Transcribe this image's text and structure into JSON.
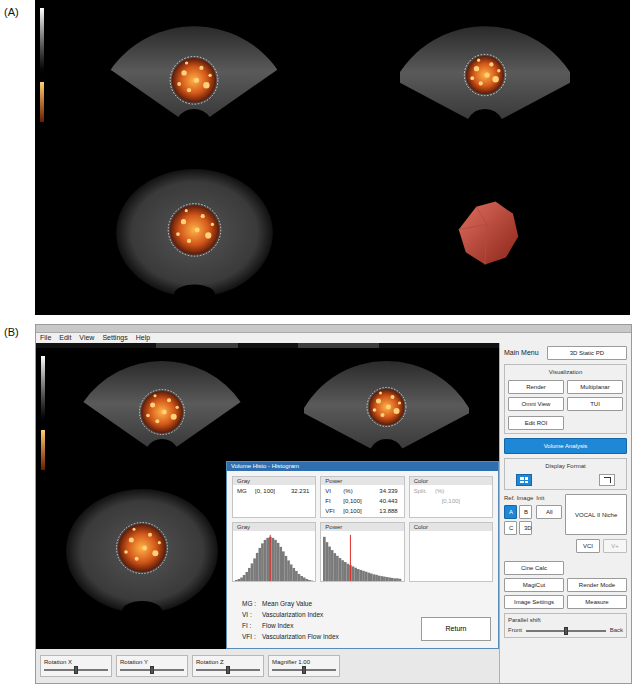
{
  "panel_a": {
    "label": "(A)"
  },
  "panel_b": {
    "label": "(B)"
  },
  "window": {
    "menu": [
      "File",
      "Edit",
      "View",
      "Settings",
      "Help"
    ]
  },
  "side_panel": {
    "title": "Main Menu",
    "mode": "3D Static PD",
    "visualization": {
      "title": "Visualization",
      "buttons": [
        {
          "label": "Render",
          "selected": false
        },
        {
          "label": "Multiplanar",
          "selected": false
        },
        {
          "label": "Omni View",
          "selected": false
        },
        {
          "label": "TUI",
          "selected": false
        }
      ]
    },
    "edit_roi": {
      "label": "Edit ROI"
    },
    "volume_analysis": {
      "label": "Volume Analysis",
      "selected": true
    },
    "display_format": {
      "title": "Display Format",
      "options": [
        {
          "selected": true
        },
        {
          "selected": false
        }
      ]
    },
    "ref_image": {
      "title": "Ref. Image",
      "options": [
        {
          "label": "A",
          "selected": true
        },
        {
          "label": "B",
          "selected": false
        },
        {
          "label": "C",
          "selected": false
        },
        {
          "label": "3D",
          "selected": false
        }
      ]
    },
    "init": {
      "title": "Init",
      "button": "All"
    },
    "vocal": {
      "label": "VOCAL II Niche"
    },
    "vci": [
      {
        "label": "VCI",
        "disabled": false
      },
      {
        "label": "V+",
        "disabled": true
      }
    ],
    "tools": [
      "Cine Calc",
      "MagiCut",
      "Render Mode",
      "Image Settings",
      "Measure"
    ],
    "parallel_shift": {
      "title": "Parallel shift",
      "left": "Front",
      "right": "Back",
      "level": 0.5
    }
  },
  "bottom_sliders": [
    {
      "label": "Rotation X",
      "level": 0.5
    },
    {
      "label": "Rotation Y",
      "level": 0.5
    },
    {
      "label": "Rotation Z",
      "level": 0.5
    },
    {
      "label": "Magnifier 1.00",
      "level": 0.5
    }
  ],
  "histogram_dialog": {
    "title": "Volume Histo - Histogram",
    "gray": {
      "title": "Gray",
      "rows": [
        {
          "label": "MG",
          "range": "[0, 100]",
          "value": "32.231"
        }
      ]
    },
    "power": {
      "title": "Power",
      "rows": [
        {
          "label": "VI",
          "range": "(%)",
          "value": "34.339"
        },
        {
          "label": "FI",
          "range": "[0,100]",
          "value": "40.443"
        },
        {
          "label": "VFI",
          "range": "[0,100]",
          "value": "13.888"
        }
      ]
    },
    "color": {
      "title": "Color",
      "disabled": true,
      "rows": [
        {
          "label": "Split.",
          "range": "(%)"
        }
      ],
      "extra": "[0,100]"
    },
    "histograms": [
      {
        "title": "Gray",
        "values": [
          2,
          4,
          7,
          12,
          18,
          26,
          35,
          45,
          56,
          66,
          75,
          82,
          86,
          88,
          86,
          82,
          76,
          68,
          59,
          50,
          41,
          33,
          26,
          20,
          14,
          10,
          7,
          4,
          2,
          1
        ],
        "marker_bin": 13
      },
      {
        "title": "Power",
        "values": [
          100,
          88,
          78,
          70,
          63,
          57,
          52,
          47,
          43,
          39,
          36,
          33,
          30,
          27,
          25,
          23,
          21,
          19,
          17,
          15,
          14,
          12,
          11,
          10,
          9,
          8,
          7,
          6,
          6,
          5
        ],
        "marker_bin": 10
      },
      {
        "title": "Color",
        "values": []
      }
    ],
    "legend": [
      {
        "abbr": "MG :",
        "text": "Mean Gray Value"
      },
      {
        "abbr": "VI :",
        "text": "Vascularization Index"
      },
      {
        "abbr": "FI :",
        "text": "Flow Index"
      },
      {
        "abbr": "VFI :",
        "text": "Vascularization Flow Index"
      }
    ],
    "return_button": "Return"
  }
}
